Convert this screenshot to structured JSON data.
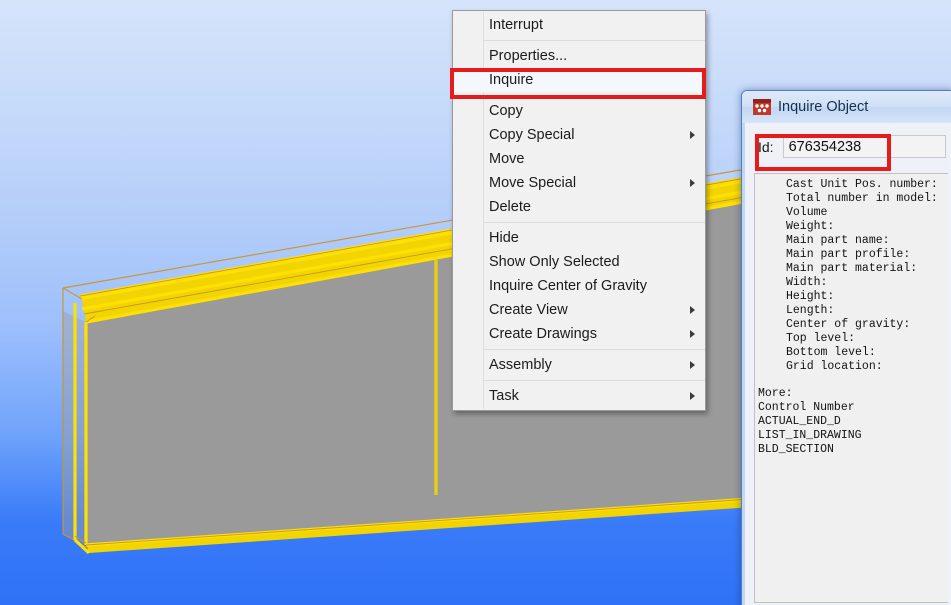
{
  "viewport": {
    "name": "3d-model-view",
    "background_top_color": "#d6e4fb",
    "background_bottom_color": "#2f72f7",
    "object_face_color": "#9a9a9a",
    "object_highlight_color": "#ffe000",
    "object_edge_color": "#c8962e"
  },
  "context_menu": {
    "name": "object-context-menu",
    "items": [
      {
        "label": "Interrupt",
        "submenu": false,
        "separator_after": true,
        "highlighted": false
      },
      {
        "label": "Properties...",
        "submenu": false,
        "separator_after": false,
        "highlighted": false
      },
      {
        "label": "Inquire",
        "submenu": false,
        "separator_after": true,
        "highlighted": true
      },
      {
        "label": "Copy",
        "submenu": false,
        "separator_after": false,
        "highlighted": false
      },
      {
        "label": "Copy Special",
        "submenu": true,
        "separator_after": false,
        "highlighted": false
      },
      {
        "label": "Move",
        "submenu": false,
        "separator_after": false,
        "highlighted": false
      },
      {
        "label": "Move Special",
        "submenu": true,
        "separator_after": false,
        "highlighted": false
      },
      {
        "label": "Delete",
        "submenu": false,
        "separator_after": true,
        "highlighted": false
      },
      {
        "label": "Hide",
        "submenu": false,
        "separator_after": false,
        "highlighted": false
      },
      {
        "label": "Show Only Selected",
        "submenu": false,
        "separator_after": false,
        "highlighted": false
      },
      {
        "label": "Inquire Center of Gravity",
        "submenu": false,
        "separator_after": false,
        "highlighted": false
      },
      {
        "label": "Create View",
        "submenu": true,
        "separator_after": false,
        "highlighted": false
      },
      {
        "label": "Create Drawings",
        "submenu": true,
        "separator_after": true,
        "highlighted": false
      },
      {
        "label": "Assembly",
        "submenu": true,
        "separator_after": true,
        "highlighted": false
      },
      {
        "label": "Task",
        "submenu": true,
        "separator_after": false,
        "highlighted": false
      }
    ]
  },
  "annotations": {
    "highlight_color": "#e61b1b",
    "inquire_menu_item_box": "Inquire",
    "id_field_box": "Id: 676354238"
  },
  "dialog": {
    "name": "inquire-object-dialog",
    "title": "Inquire Object",
    "icon": "tekla-app-icon",
    "id_label": "Id:",
    "id_value": "676354238",
    "report_lines_indented": [
      "Cast Unit Pos. number:",
      "Total number in model:",
      "Volume",
      "Weight:",
      "Main part name:",
      "Main part profile:",
      "Main part material:",
      "Width:",
      "Height:",
      "Length:",
      "Center of gravity:",
      "Top level:",
      "Bottom level:",
      "Grid location:"
    ],
    "report_lines_flush": [
      "More:",
      "Control Number",
      "ACTUAL_END_D",
      "LIST_IN_DRAWING",
      "BLD_SECTION"
    ]
  }
}
